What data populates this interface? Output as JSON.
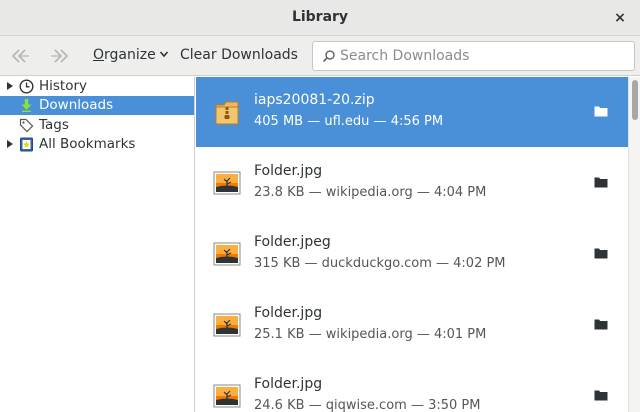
{
  "window": {
    "title": "Library",
    "close_label": "×"
  },
  "toolbar": {
    "organize_mnemonic": "O",
    "organize_rest": "rganize",
    "clear_downloads_label": "Clear Downloads",
    "search_placeholder": "Search Downloads"
  },
  "sidebar": {
    "items": [
      {
        "label": "History",
        "icon": "clock-icon",
        "expandable": true,
        "selected": false
      },
      {
        "label": "Downloads",
        "icon": "download-arrow-icon",
        "expandable": false,
        "selected": true
      },
      {
        "label": "Tags",
        "icon": "tag-icon",
        "expandable": false,
        "selected": false
      },
      {
        "label": "All Bookmarks",
        "icon": "bookmarks-icon",
        "expandable": true,
        "selected": false
      }
    ]
  },
  "downloads": [
    {
      "name": "iaps20081-20.zip",
      "size": "405 MB",
      "source": "ufl.edu",
      "time": "4:56 PM",
      "icon": "zip-archive-icon",
      "selected": true
    },
    {
      "name": "Folder.jpg",
      "size": "23.8 KB",
      "source": "wikipedia.org",
      "time": "4:04 PM",
      "icon": "image-file-icon",
      "selected": false
    },
    {
      "name": "Folder.jpeg",
      "size": "315 KB",
      "source": "duckduckgo.com",
      "time": "4:02 PM",
      "icon": "image-file-icon",
      "selected": false
    },
    {
      "name": "Folder.jpg",
      "size": "25.1 KB",
      "source": "wikipedia.org",
      "time": "4:01 PM",
      "icon": "image-file-icon",
      "selected": false
    },
    {
      "name": "Folder.jpg",
      "size": "24.6 KB",
      "source": "qiqwise.com",
      "time": "3:50 PM",
      "icon": "image-file-icon",
      "selected": false
    }
  ],
  "meta_separator": " — ",
  "colors": {
    "selection": "#4a90d9",
    "titlebar": "#e8e8e7",
    "toolbar": "#eeeeec"
  }
}
